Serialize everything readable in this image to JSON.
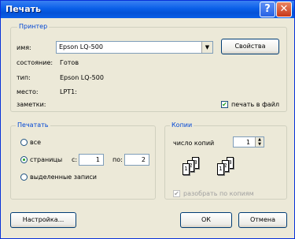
{
  "window": {
    "title": "Печать",
    "help_glyph": "?",
    "close_glyph": "✕"
  },
  "printer": {
    "group_label": "Принтер",
    "name_label": "имя:",
    "name_value": "Epson LQ-500",
    "properties_button": "Свойства",
    "status_label": "состояние:",
    "status_value": "Готов",
    "type_label": "тип:",
    "type_value": "Epson LQ-500",
    "location_label": "место:",
    "location_value": "LPT1:",
    "comment_label": "заметки:",
    "print_to_file_label": "печать в файл",
    "print_to_file_checked": true
  },
  "range": {
    "group_label": "Печатать",
    "all_label": "все",
    "pages_label": "страницы",
    "from_label": "с:",
    "from_value": "1",
    "to_label": "по:",
    "to_value": "2",
    "selection_label": "выделенные записи",
    "selected": "pages"
  },
  "copies": {
    "group_label": "Копии",
    "count_label": "число копий",
    "count_value": "1",
    "collate_label": "разобрать по копиям",
    "collate_checked": true,
    "collate_enabled": false,
    "page_numbers": [
      "1",
      "2",
      "3"
    ]
  },
  "buttons": {
    "setup": "Настройка...",
    "ok": "ОК",
    "cancel": "Отмена"
  }
}
